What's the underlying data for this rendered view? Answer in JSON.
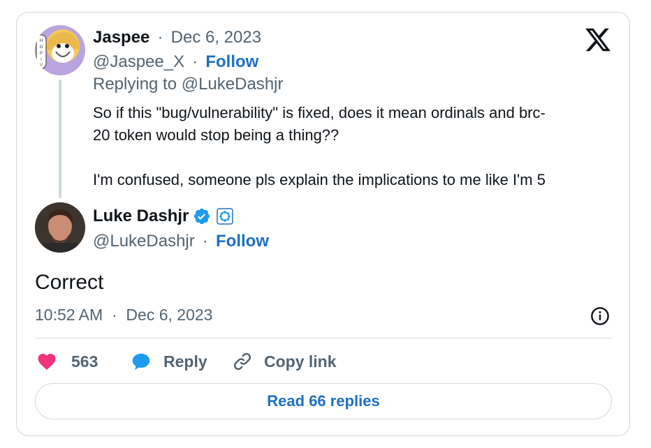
{
  "parent_tweet": {
    "author_name": "Jaspee",
    "date_sep": "·",
    "date": "Dec 6, 2023",
    "handle": "@Jaspee_X",
    "follow_sep": "·",
    "follow_label": "Follow",
    "replying_to": "Replying to @LukeDashjr",
    "text_line1": "So if this \"bug/vulnerability\" is fixed, does it mean ordinals and brc-",
    "text_line2": "20 token would stop being a thing??",
    "text_line3": "I'm confused, someone pls explain the implications to me like I'm 5",
    "avatar_text": "HOPIUM"
  },
  "main_tweet": {
    "author_name": "Luke Dashjr",
    "handle": "@LukeDashjr",
    "follow_sep": "·",
    "follow_label": "Follow",
    "text": "Correct",
    "time": "10:52 AM",
    "time_sep": "·",
    "date": "Dec 6, 2023"
  },
  "actions": {
    "like_count": "563",
    "reply_label": "Reply",
    "copy_link_label": "Copy link"
  },
  "read_replies_label": "Read 66 replies",
  "colors": {
    "accent": "#1d70c4",
    "verified": "#1d9bf0",
    "like": "#f0337a",
    "muted": "#536471",
    "border": "#cfd9de"
  }
}
